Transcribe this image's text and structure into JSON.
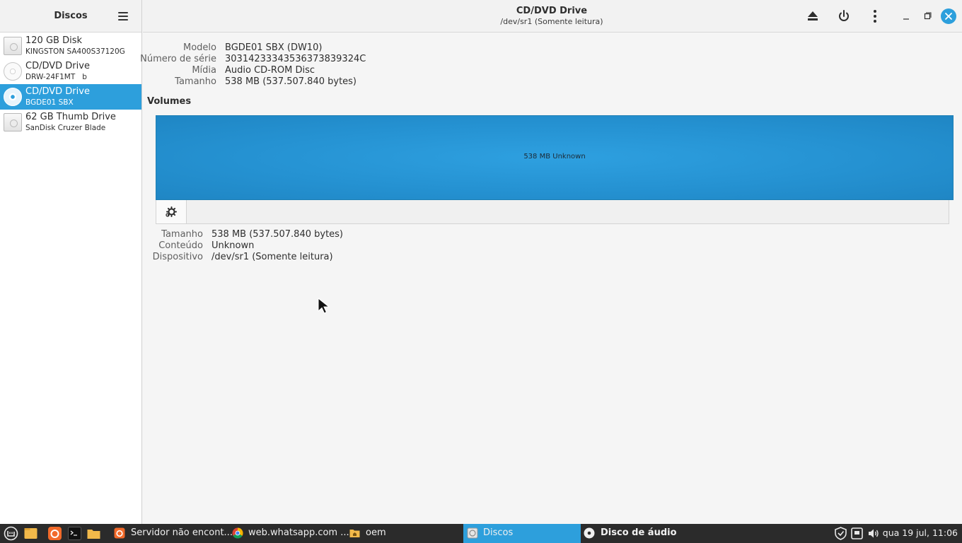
{
  "sidebar": {
    "title": "Discos",
    "disks": [
      {
        "name": "120 GB Disk",
        "sub": "KINGSTON SA400S37120G",
        "icon": "hdd-icon"
      },
      {
        "name": "CD/DVD Drive",
        "sub": "DRW-24F1MT   b",
        "icon": "optical-drive-icon"
      },
      {
        "name": "CD/DVD Drive",
        "sub": "BGDE01 SBX",
        "icon": "optical-drive-icon",
        "selected": true
      },
      {
        "name": "62 GB Thumb Drive",
        "sub": "SanDisk Cruzer Blade",
        "icon": "usb-drive-icon"
      }
    ]
  },
  "header": {
    "title": "CD/DVD Drive",
    "subtitle": "/dev/sr1 (Somente leitura)"
  },
  "drive": {
    "labels": {
      "model": "Modelo",
      "serial": "Número de série",
      "media": "Mídia",
      "size": "Tamanho"
    },
    "model": "BGDE01 SBX (DW10)",
    "serial": "30314233343536373839324C",
    "media": "Audio CD-ROM Disc",
    "size": "538 MB (537.507.840 bytes)"
  },
  "volumes": {
    "title": "Volumes",
    "bar_label": "538 MB Unknown",
    "labels": {
      "size": "Tamanho",
      "content": "Conteúdo",
      "device": "Dispositivo"
    },
    "size": "538 MB (537.507.840 bytes)",
    "content": "Unknown",
    "device": "/dev/sr1 (Somente leitura)"
  },
  "taskbar": {
    "tasks": [
      {
        "label": "Servidor não encont..."
      },
      {
        "label": "web.whatsapp.com ..."
      },
      {
        "label": "oem"
      },
      {
        "label": "Discos"
      },
      {
        "label": "Disco de áudio"
      }
    ],
    "clock": "qua 19 jul, 11:06"
  },
  "colors": {
    "accent": "#2d9fdc",
    "taskbar": "#2b2b2b",
    "close_button": "#2d9fdc"
  }
}
